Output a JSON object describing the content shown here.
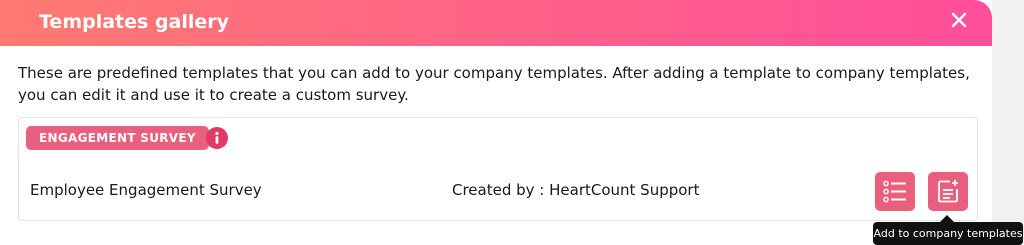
{
  "modal": {
    "title": "Templates gallery",
    "close_icon": "close-icon",
    "description": "These are predefined templates that you can add to your company templates. After adding a template to company templates, you can edit it and use it to create a custom survey."
  },
  "template": {
    "category": "ENGAGEMENT SURVEY",
    "info_icon": "info-icon",
    "name": "Employee Engagement Survey",
    "created_by": "Created by : HeartCount Support",
    "view_questions_icon": "list-icon",
    "add_icon": "add-document-icon"
  },
  "tooltip": {
    "text": "Add to company templates"
  },
  "colors": {
    "header_gradient_start": "#ff7a70",
    "header_gradient_end": "#ff4e9b",
    "accent": "#e8607d",
    "info": "#e23a66",
    "tooltip_bg": "#111111"
  }
}
